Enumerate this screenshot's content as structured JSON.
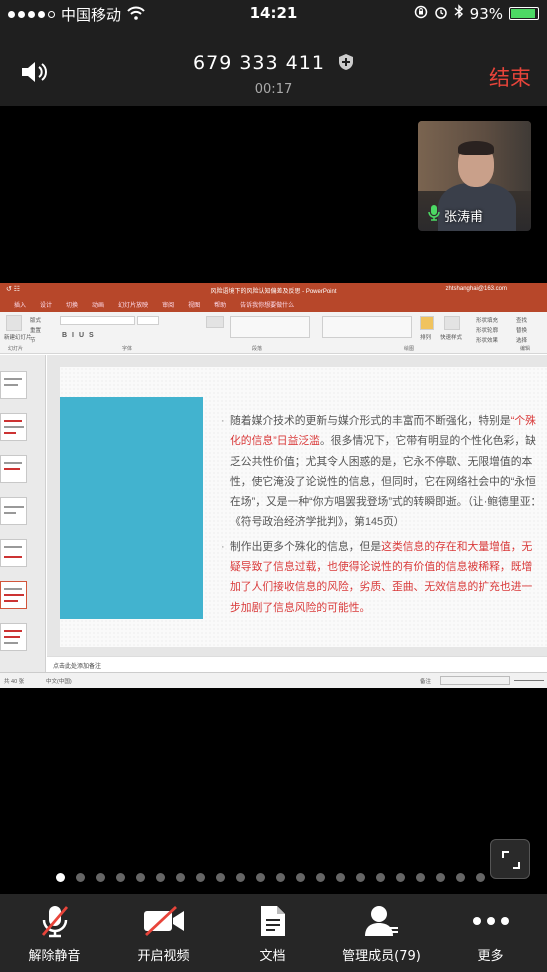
{
  "status_bar": {
    "carrier": "中国移动",
    "time": "14:21",
    "battery_percent": "93%",
    "battery_level": 0.93
  },
  "call": {
    "meeting_id": "679 333 411",
    "duration": "00:17",
    "end_label": "结束",
    "accent_color": "#e8443a"
  },
  "participant": {
    "name": "张涛甫"
  },
  "ppt": {
    "window_title": "风险语境下的风险认知偏差及反思 - PowerPoint",
    "account": "zhtshanghai@163.com",
    "tabs": [
      "插入",
      "设计",
      "切换",
      "动画",
      "幻灯片放映",
      "审阅",
      "视图",
      "帮助",
      "告诉我你想要做什么"
    ],
    "ribbon_groups": [
      "幻灯片",
      "字体",
      "段落",
      "绘图",
      "编辑"
    ],
    "ribbon_items": {
      "new_slide": "新建幻灯片",
      "layout": "版式",
      "reset": "重置",
      "section": "节",
      "arrange": "排列",
      "quick_styles": "快速样式",
      "fill": "形状填充",
      "outline": "形状轮廓",
      "effects": "形状效果",
      "find": "查找",
      "replace": "替换",
      "select": "选择"
    },
    "bullet1": {
      "lead": "随着媒介技术的更新与媒介形式的丰富而不断强化，特别是",
      "highlight": "“个殊化的信息”日益泛滥",
      "rest": "。很多情况下，它带有明显的个性化色彩，缺乏公共性价值；尤其令人困惑的是，它永不停歇、无限增值的本性，使它淹没了论说性的信息，但同时，它在网络社会中的“永恒在场”，又是一种“你方唱罢我登场”式的转瞬即逝。（让·鲍德里亚：《符号政治经济学批判》，第145页）"
    },
    "bullet2": {
      "lead": "制作出更多个殊化的信息，但是",
      "highlight": "这类信息的存在和大量增值，无疑导致了信息过载，也使得论说性的有价值的信息被稀释，既增加了人们接收信息的风险，劣质、歪曲、无效信息的扩充也进一步加剧了信息风险的可能性。"
    },
    "notes_placeholder": "点击此处添加备注",
    "slide_counter": "共 40 张",
    "language": "中文(中国)",
    "notes_button": "备注"
  },
  "pager": {
    "count": 22,
    "active_index": 0
  },
  "toolbar": {
    "items": [
      {
        "label": "解除静音"
      },
      {
        "label": "开启视频"
      },
      {
        "label": "文档"
      },
      {
        "label": "管理成员(79)"
      },
      {
        "label": "更多"
      }
    ]
  }
}
